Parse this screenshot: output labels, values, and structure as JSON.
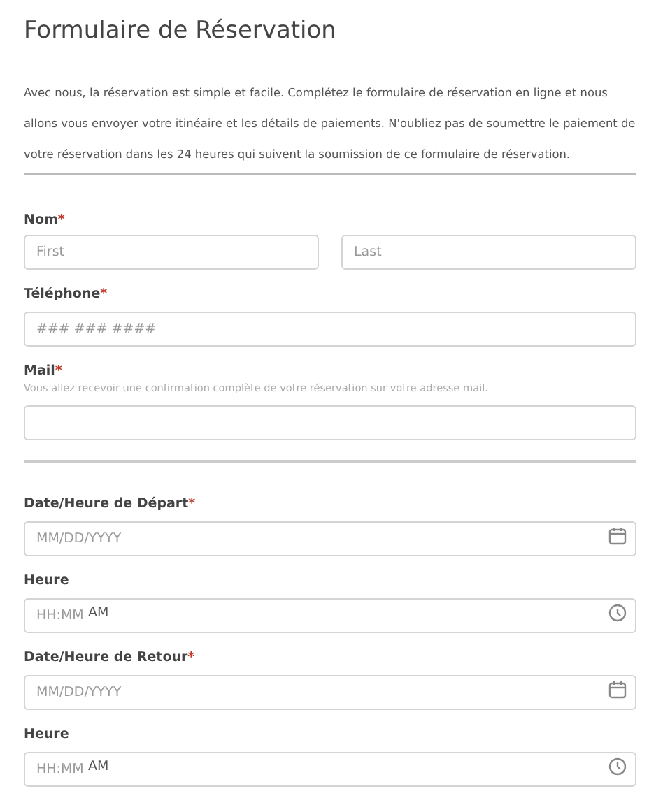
{
  "title": "Formulaire de Réservation",
  "intro": "Avec nous, la réservation est simple et facile. Complétez le formulaire de réservation en ligne et nous allons vous envoyer votre itinéaire et les détails de paiements. N'oubliez pas de soumettre le paiement de votre réservation dans les 24 heures qui suivent la soumission de ce formulaire de réservation.",
  "sections": [
    {
      "fields": [
        {
          "kind": "name",
          "label": "Nom",
          "required_mark": "*",
          "inputs": [
            {
              "placeholder": "First"
            },
            {
              "placeholder": "Last"
            }
          ]
        },
        {
          "kind": "text",
          "label": "Téléphone",
          "required_mark": "*",
          "placeholder": "### ### ####"
        },
        {
          "kind": "text",
          "label": "Mail",
          "required_mark": "*",
          "hint": "Vous allez recevoir une confirmation complète de votre réservation sur votre adresse mail."
        }
      ]
    },
    {
      "fields": [
        {
          "kind": "date",
          "label": "Date/Heure de Départ",
          "required_mark": "*",
          "placeholder": "MM/DD/YYYY"
        },
        {
          "kind": "time",
          "label": "Heure",
          "placeholder": "HH:MM",
          "ampm": "AM"
        },
        {
          "kind": "date",
          "label": "Date/Heure de Retour",
          "required_mark": "*",
          "placeholder": "MM/DD/YYYY"
        },
        {
          "kind": "time",
          "label": "Heure",
          "placeholder": "HH:MM",
          "ampm": "AM"
        }
      ]
    }
  ]
}
